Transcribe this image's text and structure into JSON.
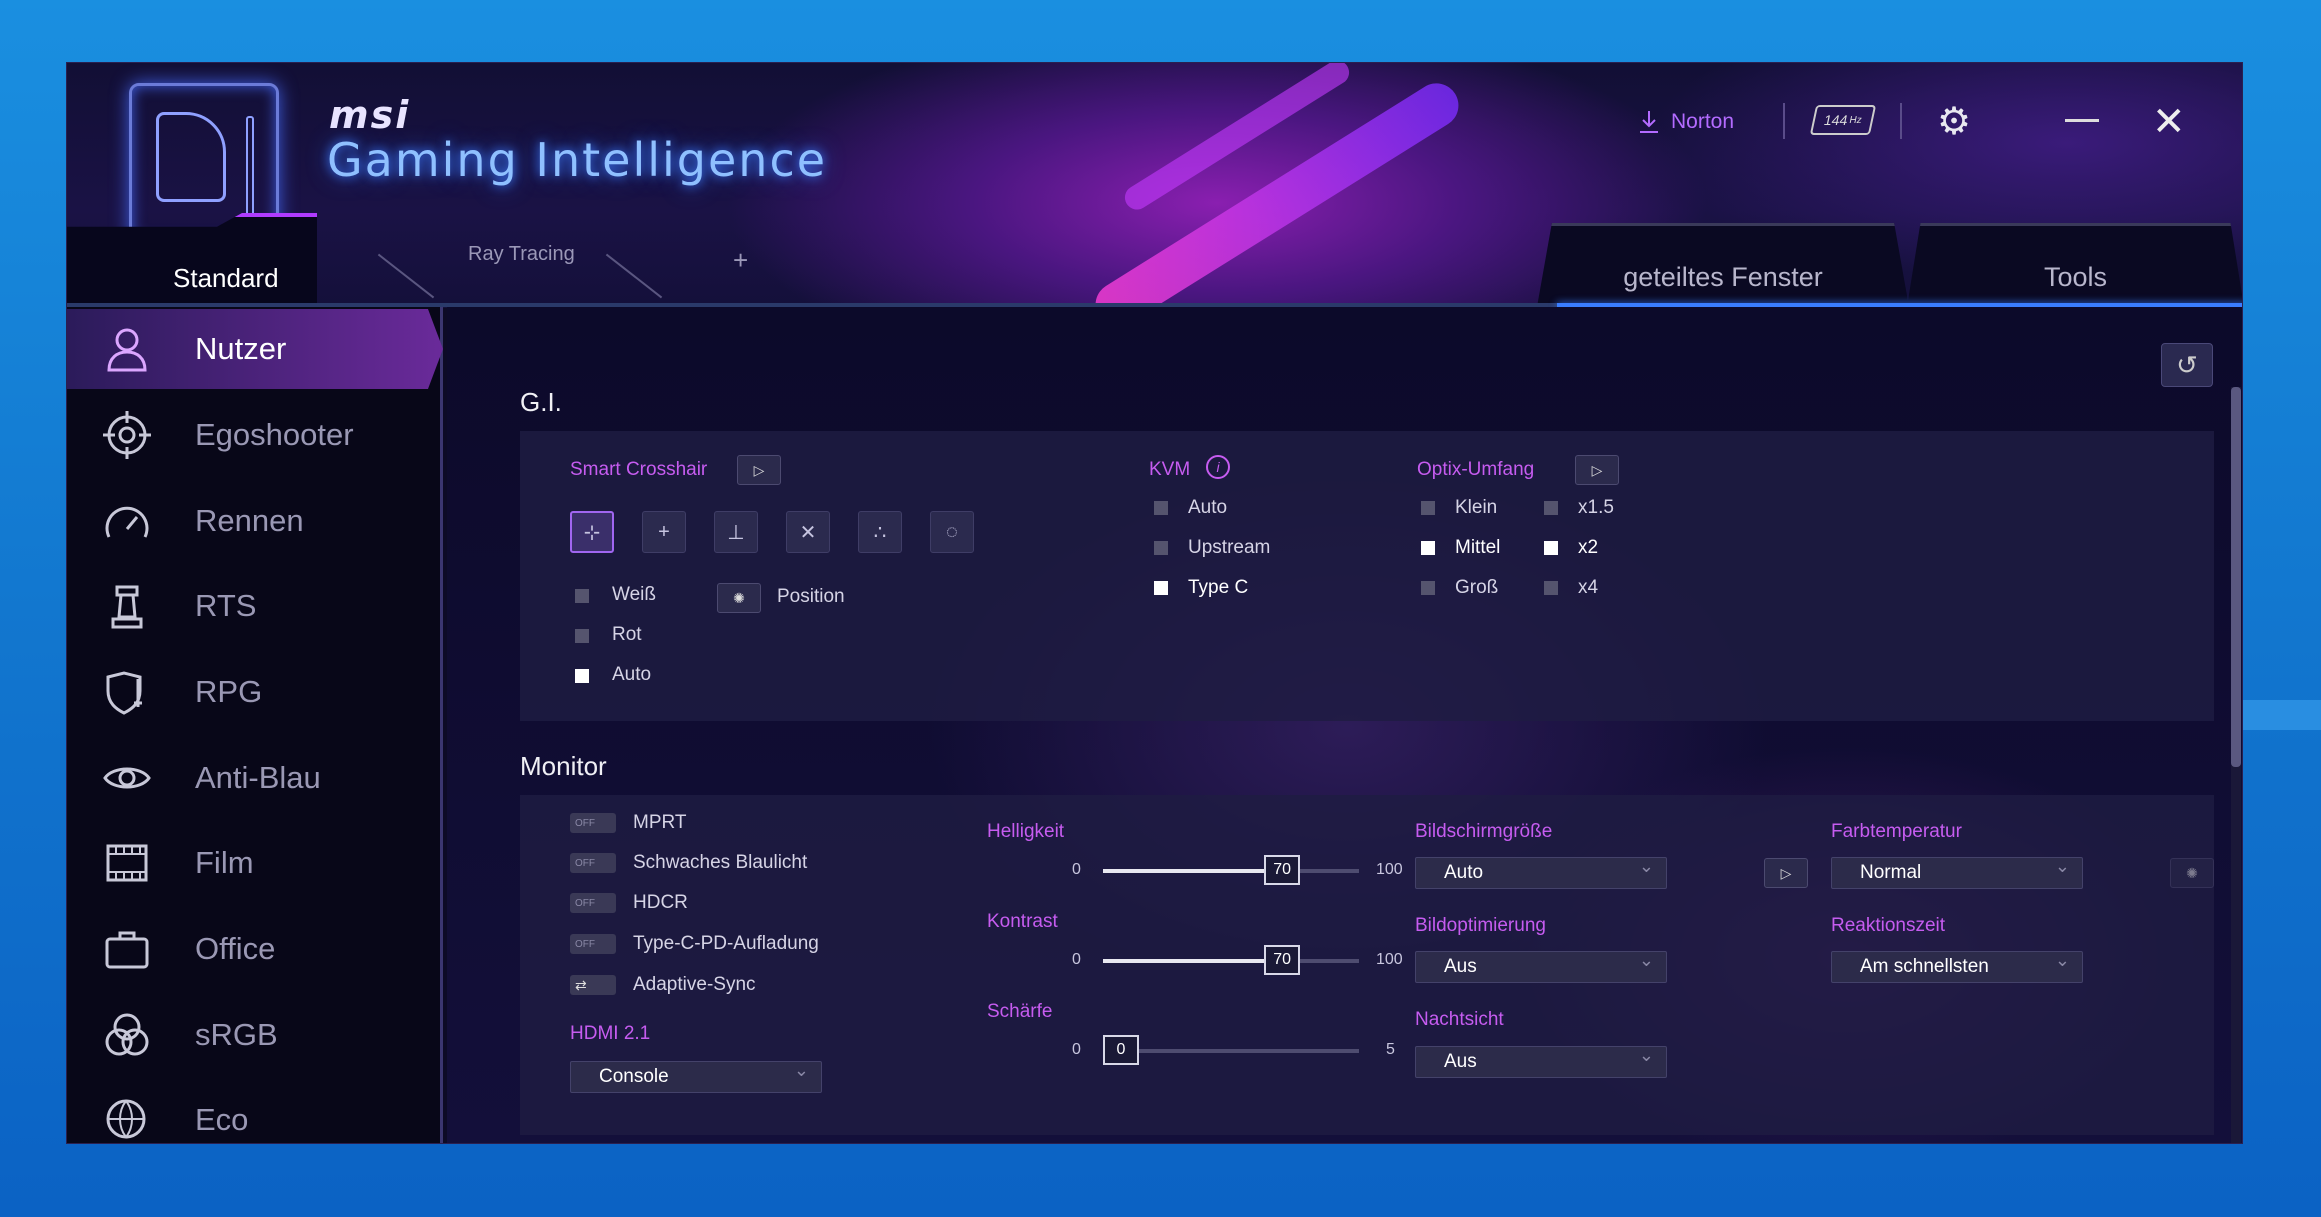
{
  "app": {
    "brand": "msi",
    "title": "Gaming Intelligence",
    "norton": "Norton",
    "refresh_badge": "144",
    "refresh_unit": "Hz"
  },
  "icons": {
    "download": "download-icon",
    "settings": "gear-icon",
    "minimize": "minimize-icon",
    "close": "close-icon",
    "reset": "reset-icon",
    "info": "info-icon"
  },
  "tabs": {
    "left": [
      {
        "label": "Standard"
      },
      {
        "label": "Ray Tracing"
      },
      {
        "label": "+"
      }
    ],
    "right": [
      {
        "label": "geteiltes Fenster"
      },
      {
        "label": "Tools"
      }
    ]
  },
  "sidebar": {
    "items": [
      {
        "label": "Nutzer",
        "icon": "user-icon",
        "active": true
      },
      {
        "label": "Egoshooter",
        "icon": "crosshair-icon"
      },
      {
        "label": "Rennen",
        "icon": "speedometer-icon"
      },
      {
        "label": "RTS",
        "icon": "chess-rook-icon"
      },
      {
        "label": "RPG",
        "icon": "shield-sword-icon"
      },
      {
        "label": "Anti-Blau",
        "icon": "eye-icon"
      },
      {
        "label": "Film",
        "icon": "film-icon"
      },
      {
        "label": "Office",
        "icon": "briefcase-icon"
      },
      {
        "label": "sRGB",
        "icon": "rgb-circles-icon"
      },
      {
        "label": "Eco",
        "icon": "globe-leaf-icon"
      }
    ]
  },
  "gi": {
    "title": "G.I.",
    "smart_crosshair": {
      "label": "Smart Crosshair",
      "colors": [
        {
          "label": "Weiß",
          "checked": false
        },
        {
          "label": "Rot",
          "checked": false
        },
        {
          "label": "Auto",
          "checked": true
        }
      ],
      "position_label": "Position"
    },
    "kvm": {
      "label": "KVM",
      "options": [
        {
          "label": "Auto",
          "checked": false
        },
        {
          "label": "Upstream",
          "checked": false
        },
        {
          "label": "Type C",
          "checked": true
        }
      ]
    },
    "optix": {
      "label": "Optix-Umfang",
      "sizes": [
        {
          "label": "Klein",
          "checked": false
        },
        {
          "label": "Mittel",
          "checked": true
        },
        {
          "label": "Groß",
          "checked": false
        }
      ],
      "zoom": [
        {
          "label": "x1.5",
          "checked": false
        },
        {
          "label": "x2",
          "checked": true
        },
        {
          "label": "x4",
          "checked": false
        }
      ]
    }
  },
  "monitor": {
    "title": "Monitor",
    "toggles": [
      {
        "label": "MPRT",
        "state": "OFF"
      },
      {
        "label": "Schwaches Blaulicht",
        "state": "OFF"
      },
      {
        "label": "HDCR",
        "state": "OFF"
      },
      {
        "label": "Type-C-PD-Aufladung",
        "state": "OFF"
      },
      {
        "label": "Adaptive-Sync",
        "state": "sync"
      }
    ],
    "hdmi": {
      "label": "HDMI 2.1",
      "value": "Console"
    },
    "helligkeit": {
      "label": "Helligkeit",
      "min": "0",
      "max": "100",
      "value": "70",
      "fraction": 0.7
    },
    "kontrast": {
      "label": "Kontrast",
      "min": "0",
      "max": "100",
      "value": "70",
      "fraction": 0.7
    },
    "schaerfe": {
      "label": "Schärfe",
      "min": "0",
      "max": "5",
      "value": "0",
      "fraction": 0
    },
    "bildschirmgroesse": {
      "label": "Bildschirmgröße",
      "value": "Auto"
    },
    "bildoptimierung": {
      "label": "Bildoptimierung",
      "value": "Aus"
    },
    "nachtsicht": {
      "label": "Nachtsicht",
      "value": "Aus"
    },
    "farbtemperatur": {
      "label": "Farbtemperatur",
      "value": "Normal"
    },
    "reaktionszeit": {
      "label": "Reaktionszeit",
      "value": "Am schnellsten"
    }
  }
}
